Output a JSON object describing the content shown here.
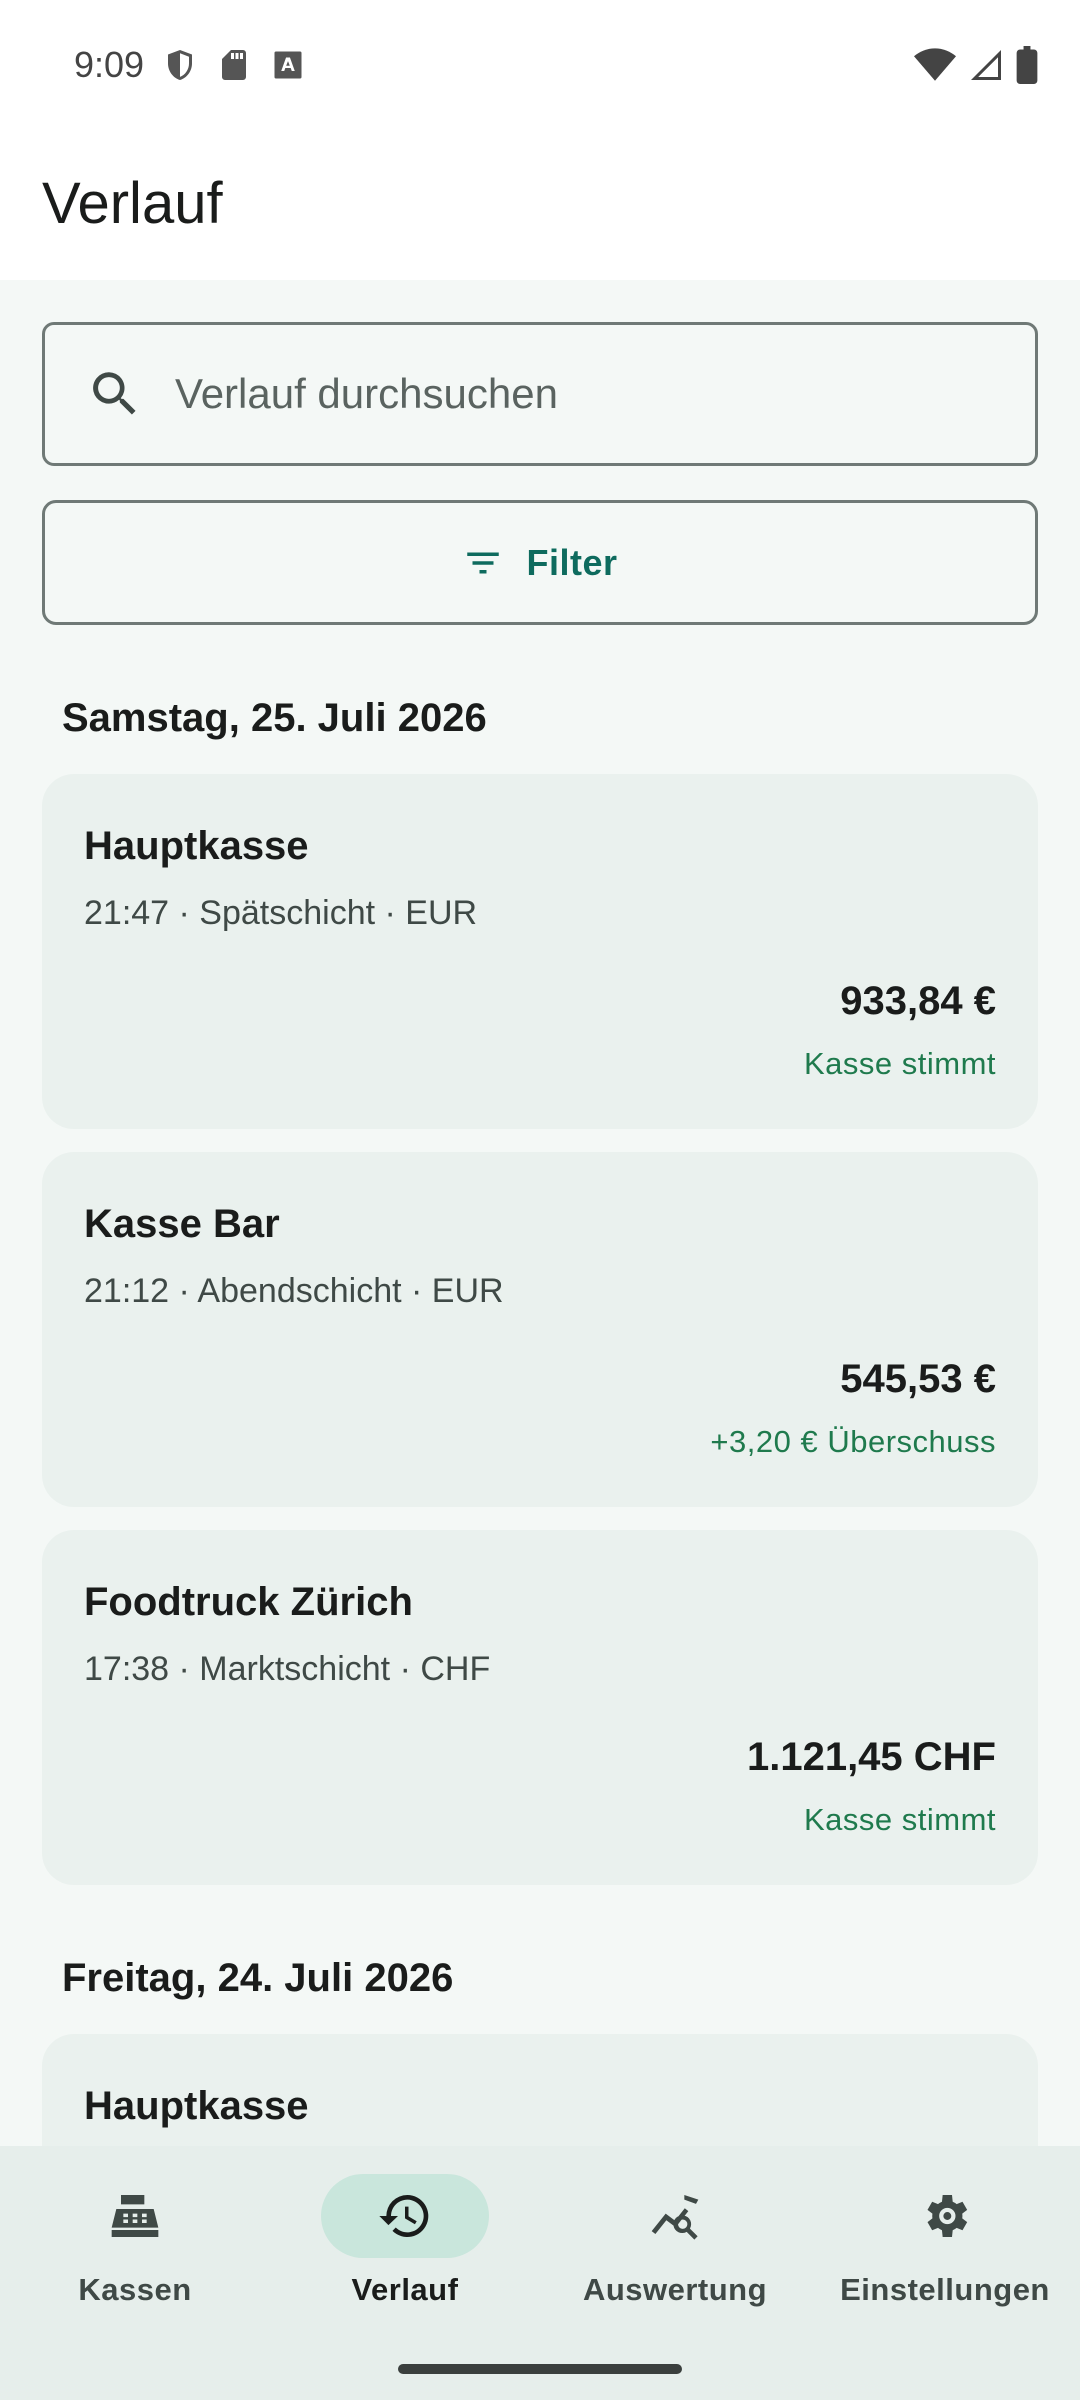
{
  "status_bar": {
    "time": "9:09",
    "icons_left": [
      "shield-icon",
      "sd-card-icon",
      "keyboard-a-icon"
    ],
    "icons_right": [
      "wifi-icon",
      "cell-signal-icon",
      "battery-icon"
    ]
  },
  "header": {
    "title": "Verlauf"
  },
  "search": {
    "placeholder": "Verlauf durchsuchen",
    "icon": "search-icon"
  },
  "filter": {
    "label": "Filter",
    "icon": "filter-list-icon"
  },
  "groups": [
    {
      "date": "Samstag, 25. Juli 2026",
      "entries": [
        {
          "title": "Hauptkasse",
          "subtitle": "21:47 · Spätschicht · EUR",
          "amount": "933,84 €",
          "status": "Kasse stimmt"
        },
        {
          "title": "Kasse Bar",
          "subtitle": "21:12 · Abendschicht · EUR",
          "amount": "545,53 €",
          "status": "+3,20 € Überschuss"
        },
        {
          "title": "Foodtruck Zürich",
          "subtitle": "17:38 · Marktschicht · CHF",
          "amount": "1.121,45 CHF",
          "status": "Kasse stimmt"
        }
      ]
    },
    {
      "date": "Freitag, 24. Juli 2026",
      "entries": [
        {
          "title": "Hauptkasse"
        }
      ]
    }
  ],
  "nav": {
    "items": [
      {
        "label": "Kassen",
        "icon": "cash-register-icon",
        "active": false
      },
      {
        "label": "Verlauf",
        "icon": "history-icon",
        "active": true
      },
      {
        "label": "Auswertung",
        "icon": "chart-search-icon",
        "active": false
      },
      {
        "label": "Einstellungen",
        "icon": "gear-icon",
        "active": false
      }
    ]
  },
  "colors": {
    "accent": "#0e6b5e",
    "positive": "#1f7a4d",
    "card": "#eaf1ee",
    "nav_active_pill": "#c9e6dc"
  }
}
